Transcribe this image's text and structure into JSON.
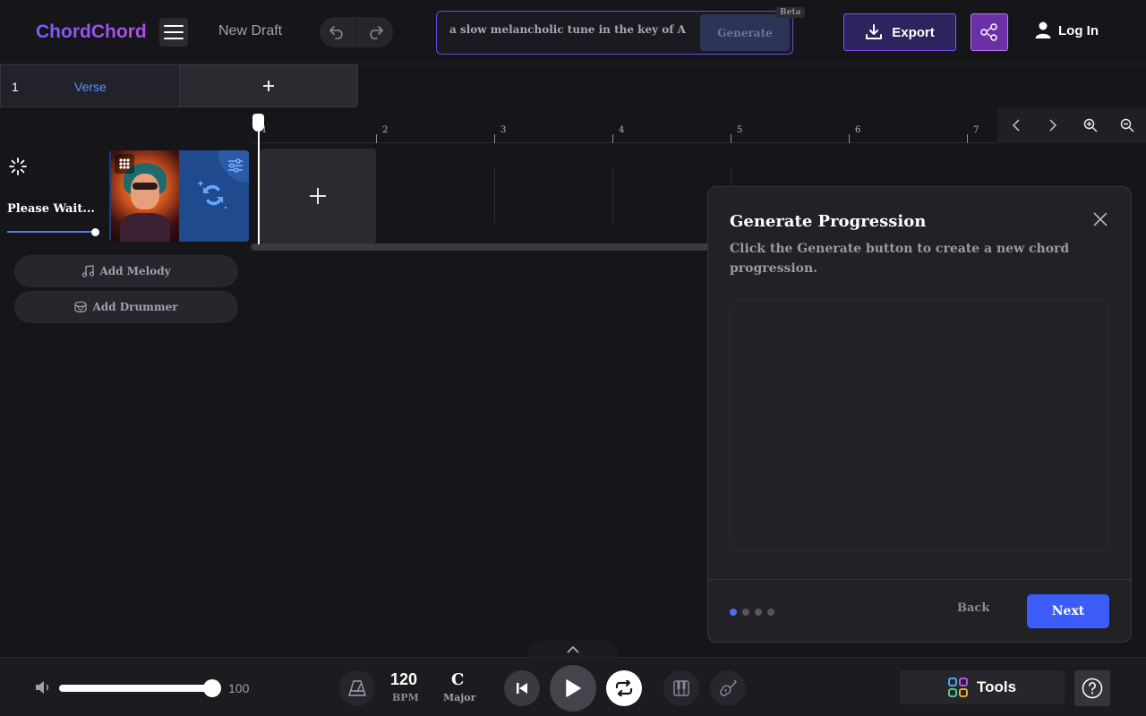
{
  "header": {
    "logo": "ChordChord",
    "draft_title": "New Draft",
    "prompt_value": "a slow melancholic tune in the key of A minor",
    "generate_label": "Generate",
    "beta_badge": "Beta",
    "export_label": "Export",
    "login_label": "Log In"
  },
  "sections": {
    "items": [
      {
        "number": "1",
        "label": "Verse"
      }
    ],
    "add_label": "+"
  },
  "ruler": {
    "bars": [
      "1",
      "2",
      "3",
      "4",
      "5",
      "6",
      "7"
    ]
  },
  "track": {
    "status": "Please Wait...",
    "progress": 1.0
  },
  "actions": {
    "add_melody": "Add Melody",
    "add_drummer": "Add Drummer"
  },
  "dialog": {
    "title": "Generate Progression",
    "subtitle": "Click the Generate button to create a new chord progression.",
    "step_current": 1,
    "step_total": 4,
    "back_label": "Back",
    "next_label": "Next"
  },
  "footer": {
    "volume": "100",
    "volume_fraction": 1.0,
    "bpm_value": "120",
    "bpm_label": "BPM",
    "key_value": "C",
    "key_mode": "Major",
    "tools_label": "Tools"
  },
  "colors": {
    "accent": "#3b5cf6",
    "brand_start": "#7b5cff",
    "brand_end": "#b04ee0"
  }
}
